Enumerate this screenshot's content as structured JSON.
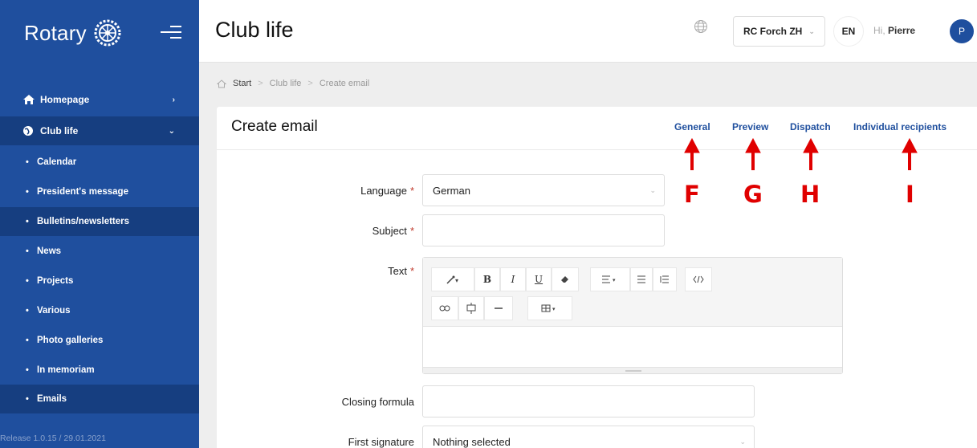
{
  "sidebar": {
    "brand": "Rotary",
    "top_items": [
      {
        "label": "Homepage",
        "chevron": "›"
      },
      {
        "label": "Club life",
        "chevron": "⌄"
      }
    ],
    "sub_items": [
      {
        "label": "Calendar"
      },
      {
        "label": "President's message"
      },
      {
        "label": "Bulletins/newsletters"
      },
      {
        "label": "News"
      },
      {
        "label": "Projects"
      },
      {
        "label": "Various"
      },
      {
        "label": "Photo galleries"
      },
      {
        "label": "In memoriam"
      },
      {
        "label": "Emails"
      }
    ],
    "bullet": "•",
    "release": "Release 1.0.15 / 29.01.2021"
  },
  "header": {
    "title": "Club life",
    "club": "RC Forch ZH",
    "language": "EN",
    "greeting": "Hi,",
    "user": "Pierre",
    "avatar_letter": "P"
  },
  "breadcrumb": [
    "Start",
    "Club life",
    "Create email"
  ],
  "card": {
    "title": "Create email",
    "tabs": [
      "General",
      "Preview",
      "Dispatch",
      "Individual recipients"
    ]
  },
  "form": {
    "language_label": "Language",
    "language_value": "German",
    "subject_label": "Subject",
    "subject_value": "",
    "text_label": "Text",
    "closing_label": "Closing formula",
    "closing_value": "",
    "signature_label": "First signature",
    "signature_value": "Nothing selected",
    "required_mark": "*"
  },
  "annotations": [
    "F",
    "G",
    "H",
    "I"
  ],
  "colors": {
    "brand_blue": "#1f4f9e",
    "active_item": "#163e80",
    "annotation_red": "#e00000"
  }
}
